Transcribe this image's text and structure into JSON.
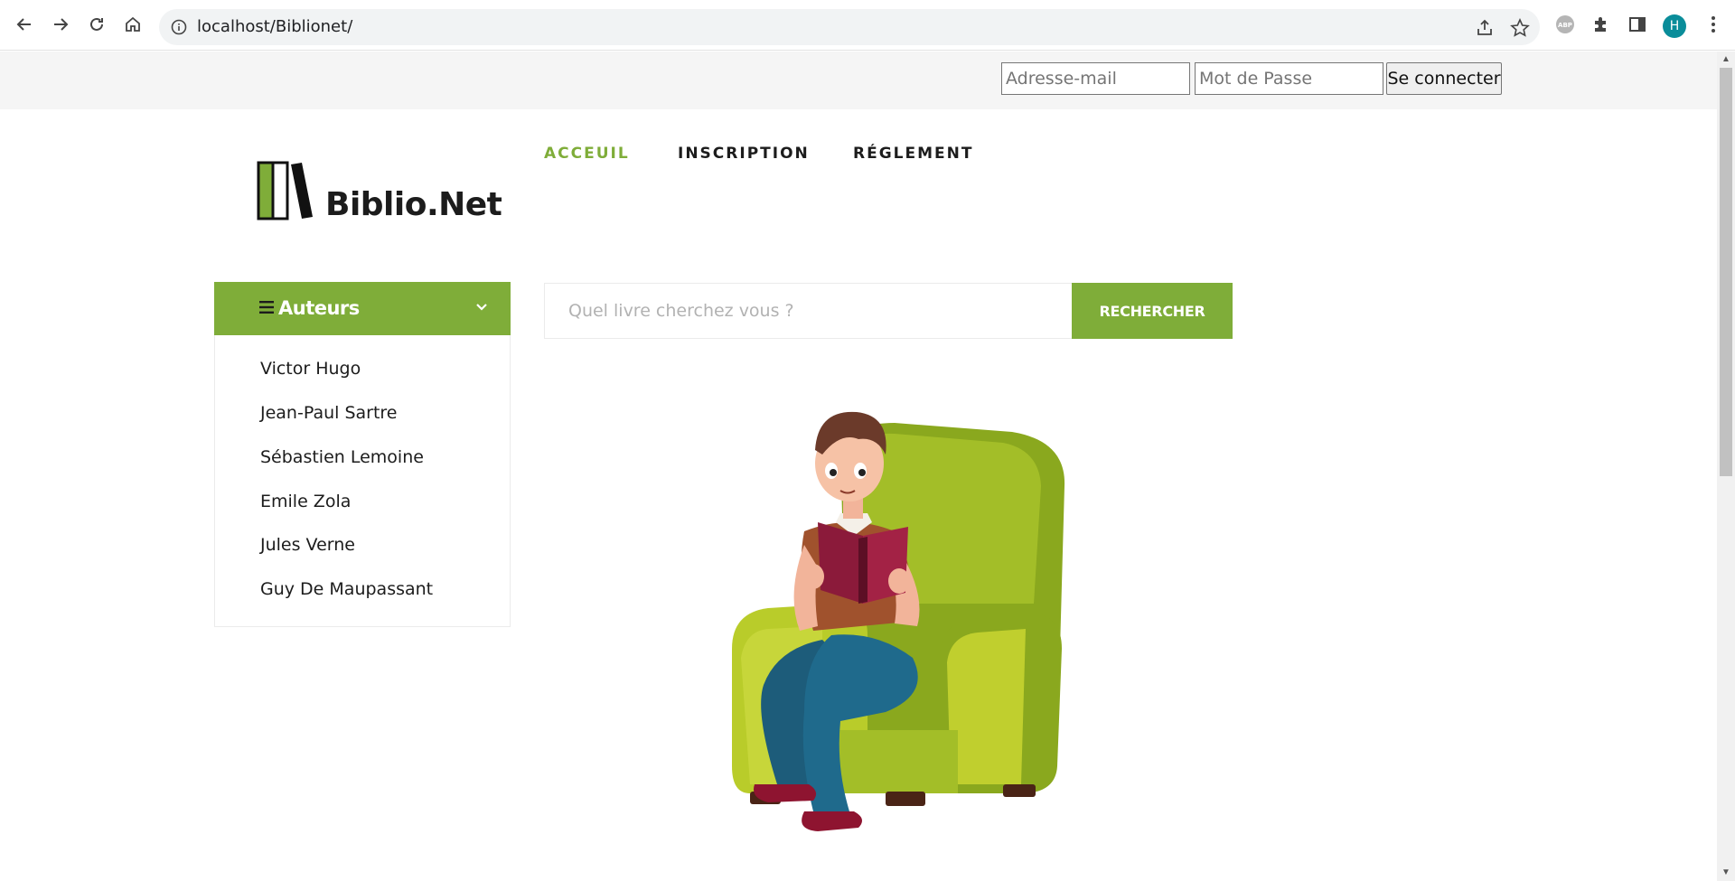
{
  "browser": {
    "url": "localhost/Biblionet/",
    "profile_initial": "H",
    "extensions": [
      "adblock-icon",
      "puzzle-icon",
      "sidepanel-icon"
    ]
  },
  "login": {
    "email_placeholder": "Adresse-mail",
    "password_placeholder": "Mot de Passe",
    "submit_label": "Se connecter"
  },
  "brand": {
    "name": "Biblio.Net",
    "accent_color": "#7fad39"
  },
  "nav": {
    "items": [
      {
        "label": "ACCEUIL",
        "active": true
      },
      {
        "label": "INSCRIPTION",
        "active": false
      },
      {
        "label": "RÉGLEMENT",
        "active": false
      }
    ]
  },
  "authors": {
    "title": "Auteurs",
    "items": [
      {
        "label": "Victor Hugo"
      },
      {
        "label": "Jean-Paul Sartre"
      },
      {
        "label": "Sébastien Lemoine"
      },
      {
        "label": "Emile Zola"
      },
      {
        "label": "Jules Verne"
      },
      {
        "label": "Guy De Maupassant"
      }
    ]
  },
  "search": {
    "placeholder": "Quel livre cherchez vous ?",
    "button_label": "RECHERCHER"
  },
  "hero": {
    "illustration": "man-reading-in-armchair"
  }
}
